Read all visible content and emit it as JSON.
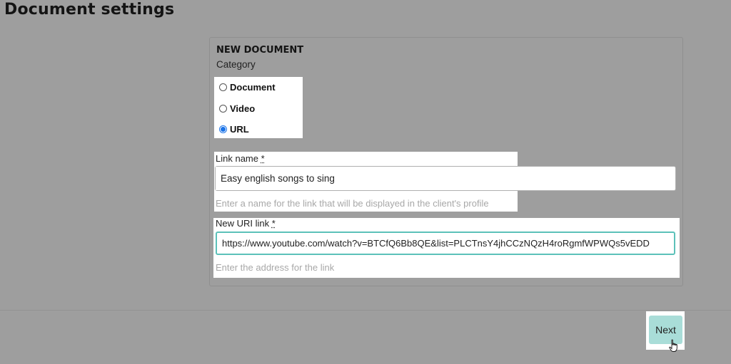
{
  "page": {
    "title": "Document settings"
  },
  "form": {
    "section_title": "NEW DOCUMENT",
    "category_label": "Category",
    "categories": [
      {
        "label": "Document",
        "checked": false
      },
      {
        "label": "Video",
        "checked": false
      },
      {
        "label": "URL",
        "checked": true
      }
    ],
    "link_name": {
      "label": "Link name",
      "required_mark": "*",
      "value": "Easy english songs to sing",
      "helper": "Enter a name for the link that will be displayed in the client's profile"
    },
    "url": {
      "label": "New URI link",
      "required_mark": "*",
      "value": "https://www.youtube.com/watch?v=BTCfQ6Bb8QE&list=PLCTnsY4jhCCzNQzH4roRgmfWPWQs5vEDD",
      "helper": "Enter the address for the link"
    }
  },
  "footer": {
    "next_label": "Next"
  },
  "colors": {
    "accent": "#a9ddd8",
    "focus": "#5cc1b9",
    "overlay": "#9e9e9e",
    "radio": "#1a73e8"
  },
  "icons": {
    "cursor": "hand-pointer-icon"
  }
}
